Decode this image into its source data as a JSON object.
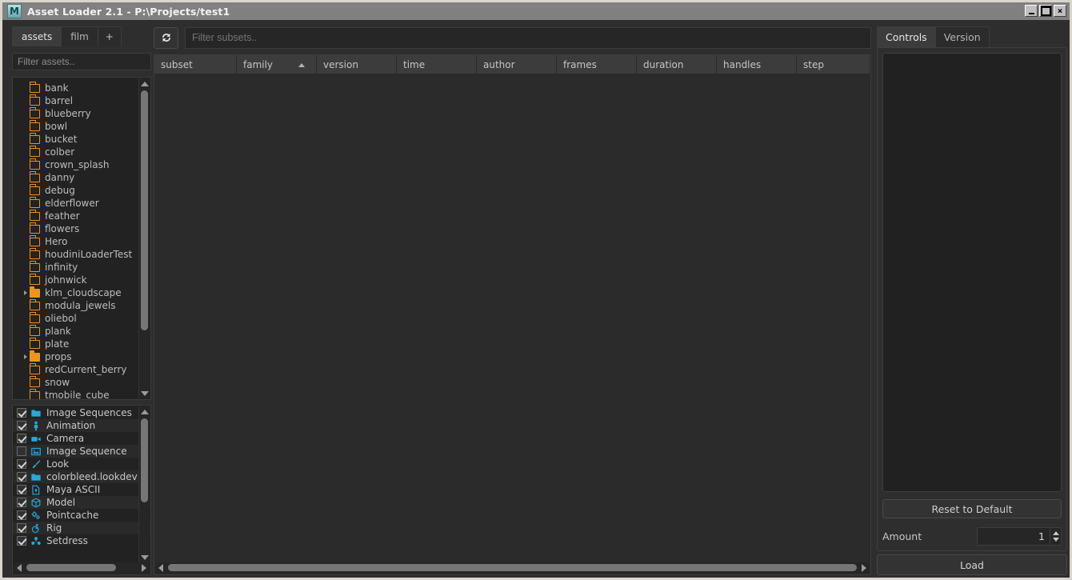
{
  "window": {
    "title": "Asset Loader 2.1 - P:\\Projects/test1",
    "icon": "maya-m-icon",
    "icon_letter": "M",
    "minimize_label": "",
    "maximize_label": "",
    "close_label": "×"
  },
  "left": {
    "tabs": [
      {
        "label": "assets",
        "active": true
      },
      {
        "label": "film",
        "active": false
      },
      {
        "label": "+",
        "active": false
      }
    ],
    "asset_filter": {
      "placeholder": "Filter assets..",
      "value": ""
    },
    "asset_tree": [
      {
        "label": "bank",
        "icon": "folder-outline-icon",
        "expandable": false
      },
      {
        "label": "barrel",
        "icon": "folder-outline-icon",
        "expandable": false
      },
      {
        "label": "blueberry",
        "icon": "folder-outline-icon",
        "expandable": false
      },
      {
        "label": "bowl",
        "icon": "folder-outline-icon",
        "expandable": false
      },
      {
        "label": "bucket",
        "icon": "folder-outline-icon",
        "expandable": false
      },
      {
        "label": "colber",
        "icon": "folder-outline-icon",
        "expandable": false
      },
      {
        "label": "crown_splash",
        "icon": "folder-outline-icon",
        "expandable": false
      },
      {
        "label": "danny",
        "icon": "folder-outline-icon",
        "expandable": false
      },
      {
        "label": "debug",
        "icon": "folder-outline-icon",
        "expandable": false
      },
      {
        "label": "elderflower",
        "icon": "folder-outline-icon",
        "expandable": false
      },
      {
        "label": "feather",
        "icon": "folder-outline-icon",
        "expandable": false
      },
      {
        "label": "flowers",
        "icon": "folder-outline-icon",
        "expandable": false
      },
      {
        "label": "Hero",
        "icon": "folder-outline-icon",
        "expandable": false
      },
      {
        "label": "houdiniLoaderTest",
        "icon": "folder-outline-icon",
        "expandable": false
      },
      {
        "label": "infinity",
        "icon": "folder-outline-icon",
        "expandable": false
      },
      {
        "label": "johnwick",
        "icon": "folder-outline-icon",
        "expandable": false
      },
      {
        "label": "klm_cloudscape",
        "icon": "folder-filled-icon",
        "expandable": true
      },
      {
        "label": "modula_jewels",
        "icon": "folder-outline-icon",
        "expandable": false
      },
      {
        "label": "oliebol",
        "icon": "folder-outline-icon",
        "expandable": false
      },
      {
        "label": "plank",
        "icon": "folder-outline-icon",
        "expandable": false
      },
      {
        "label": "plate",
        "icon": "folder-outline-icon",
        "expandable": false
      },
      {
        "label": "props",
        "icon": "folder-filled-icon",
        "expandable": true
      },
      {
        "label": "redCurrent_berry",
        "icon": "folder-outline-icon",
        "expandable": false
      },
      {
        "label": "snow",
        "icon": "folder-outline-icon",
        "expandable": false
      },
      {
        "label": "tmobile_cube",
        "icon": "folder-outline-icon",
        "expandable": false
      }
    ],
    "family_list": [
      {
        "label": "Image Sequences",
        "icon": "folder-icon",
        "checked": true
      },
      {
        "label": "Animation",
        "icon": "person-icon",
        "checked": true
      },
      {
        "label": "Camera",
        "icon": "video-camera-icon",
        "checked": true
      },
      {
        "label": "Image Sequence",
        "icon": "image-icon",
        "checked": false
      },
      {
        "label": "Look",
        "icon": "paintbrush-icon",
        "checked": true
      },
      {
        "label": "colorbleed.lookdev",
        "icon": "folder-icon",
        "checked": true
      },
      {
        "label": "Maya ASCII",
        "icon": "document-icon",
        "checked": true
      },
      {
        "label": "Model",
        "icon": "cube-icon",
        "checked": true
      },
      {
        "label": "Pointcache",
        "icon": "gears-icon",
        "checked": true
      },
      {
        "label": "Rig",
        "icon": "rig-icon",
        "checked": true
      },
      {
        "label": "Setdress",
        "icon": "setdress-icon",
        "checked": true
      }
    ]
  },
  "center": {
    "refresh_icon": "refresh-icon",
    "subset_filter": {
      "placeholder": "Filter subsets..",
      "value": ""
    },
    "columns": [
      {
        "label": "subset",
        "width": 103,
        "sorted": false
      },
      {
        "label": "family",
        "width": 100,
        "sorted": true,
        "sort_direction": "asc"
      },
      {
        "label": "version",
        "width": 100,
        "sorted": false
      },
      {
        "label": "time",
        "width": 100,
        "sorted": false
      },
      {
        "label": "author",
        "width": 100,
        "sorted": false
      },
      {
        "label": "frames",
        "width": 100,
        "sorted": false
      },
      {
        "label": "duration",
        "width": 100,
        "sorted": false
      },
      {
        "label": "handles",
        "width": 100,
        "sorted": false
      },
      {
        "label": "step",
        "width": 92,
        "sorted": false
      }
    ],
    "rows": []
  },
  "right": {
    "tabs": [
      {
        "label": "Controls",
        "active": true
      },
      {
        "label": "Version",
        "active": false
      }
    ],
    "reset_label": "Reset to Default",
    "amount_label": "Amount",
    "amount_value": "1",
    "load_label": "Load"
  },
  "colors": {
    "background": "#2e2e2e",
    "panel": "#2b2b2b",
    "field": "#262626",
    "folder_accent": "#e8912a",
    "family_accent": "#2aa8d8",
    "titlebar": "#808080",
    "frame": "#d8d6cc"
  }
}
